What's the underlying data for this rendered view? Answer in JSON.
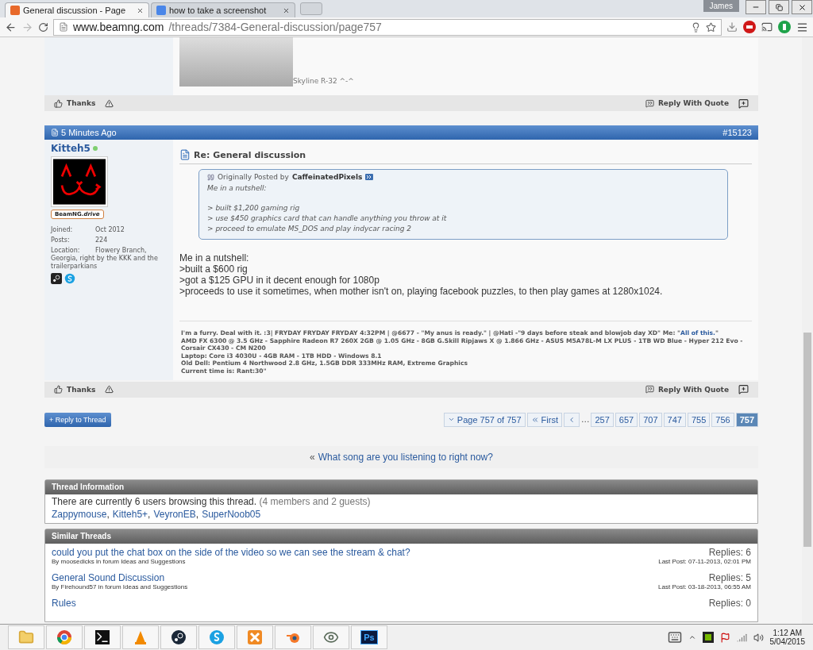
{
  "browser": {
    "tabs": [
      {
        "title": "General discussion - Page",
        "selected": true
      },
      {
        "title": "how to take a screenshot",
        "selected": false
      }
    ],
    "user": "James",
    "url": {
      "host": "www.beamng.com",
      "path": "/threads/7384-General-discussion/page757"
    }
  },
  "previous_post": {
    "caption": "Skyline R-32 ^-^",
    "actions": {
      "thanks": "Thanks",
      "reply_with_quote": "Reply With Quote"
    }
  },
  "post": {
    "time": "5 Minutes Ago",
    "number": "#15123",
    "author": {
      "name": "Kitteh5",
      "online": true,
      "badge": "BeamNG.*drive*",
      "stats": [
        {
          "label": "Joined:",
          "value": "Oct 2012"
        },
        {
          "label": "Posts:",
          "value": "224"
        },
        {
          "label": "Location:",
          "value": "Flowery Branch, Georgia, right by the KKK and the trailerparkians"
        }
      ]
    },
    "title": "Re: General discussion",
    "quote": {
      "prefix": "Originally Posted by",
      "author": "CaffeinatedPixels",
      "paragraphs": [
        [
          "Me in a nutshell:"
        ],
        [
          "> built $1,200 gaming rig",
          "> use $450 graphics card that can handle anything you throw at it",
          "> proceed to emulate MS_DOS and play indycar racing 2"
        ]
      ]
    },
    "message": [
      "Me in a nutshell:",
      ">built a $600 rig",
      ">got a $125 GPU in it decent enough for 1080p",
      ">proceeds to use it sometimes, when mother isn't on, playing facebook puzzles, to then play games at 1280x1024."
    ],
    "signature": {
      "first": {
        "before": "I'm a furry. Deal with it. :3| FRYDAY FRYDAY FRYDAY 4:32PM | @6677 - \"My anus is ready.\" | @Hati -\"9 days before steak and blowjob day XD\" Me: \"",
        "link": "All of this.",
        "after": "\""
      },
      "lines": [
        "AMD FX 6300 @ 3.5 GHz - Sapphire Radeon R7 260X 2GB @ 1.05 GHz - 8GB G.Skill Ripjaws X @ 1.866 GHz - ASUS M5A78L-M LX PLUS - 1TB WD Blue - Hyper 212 Evo - Corsair CX430 - CM N200",
        "Laptop: Core i3 4030U - 4GB RAM - 1TB HDD - Windows 8.1",
        "Old Dell: Pentium 4 Northwood 2.8 GHz, 1.5GB DDR 333MHz RAM, Extreme Graphics",
        "Current time is: Rant:30\""
      ]
    },
    "actions": {
      "thanks": "Thanks",
      "reply_with_quote": "Reply With Quote"
    }
  },
  "reply_button": "+ Reply to Thread",
  "pagination": {
    "label": "Page 757 of 757",
    "first": "First",
    "ellipsis": "...",
    "pages": [
      {
        "label": "257",
        "selected": false
      },
      {
        "label": "657",
        "selected": false
      },
      {
        "label": "707",
        "selected": false
      },
      {
        "label": "747",
        "selected": false
      },
      {
        "label": "755",
        "selected": false
      },
      {
        "label": "756",
        "selected": false
      },
      {
        "label": "757",
        "selected": true
      }
    ]
  },
  "thread_nav": {
    "arrow": "«",
    "link": "What song are you listening to right now?"
  },
  "thread_information": {
    "title": "Thread Information",
    "text": "There are currently 6 users browsing this thread.",
    "detail": "(4 members and 2 guests)",
    "separator": ",",
    "users": [
      "Zappymouse",
      "Kitteh5+",
      "VeyronEB",
      "SuperNoob05"
    ]
  },
  "similar_threads": {
    "title": "Similar Threads",
    "rows": [
      {
        "title": "could you put the chat box on the side of the video so we can see the stream & chat?",
        "byline": "By moosedicks in forum Ideas and Suggestions",
        "replies": "Replies: 6",
        "last_post": "Last Post: 07-11-2013, 02:01 PM"
      },
      {
        "title": "General Sound Discussion",
        "byline": "By Firehound57 in forum Ideas and Suggestions",
        "replies": "Replies: 5",
        "last_post": "Last Post: 03-18-2013, 06:55 AM"
      },
      {
        "title": "Rules",
        "replies": "Replies: 0"
      }
    ]
  },
  "taskbar": {
    "photoshop_label": "Ps",
    "time": "1:12 AM",
    "date": "5/04/2015"
  }
}
